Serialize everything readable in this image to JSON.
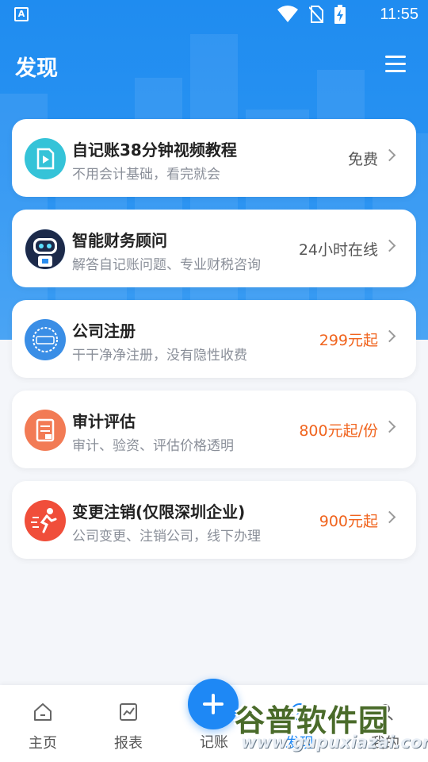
{
  "status_bar": {
    "time": "11:55",
    "app_badge": "A"
  },
  "header": {
    "title": "发现"
  },
  "cards": [
    {
      "title": "自记账38分钟视频教程",
      "subtitle": "不用会计基础，看完就会",
      "right": "免费",
      "right_color": "#555555",
      "icon": "video-tutorial-icon",
      "icon_color": "#35c3d8"
    },
    {
      "title": "智能财务顾问",
      "subtitle": "解答自记账问题、专业财税咨询",
      "right": "24小时在线",
      "right_color": "#555555",
      "icon": "robot-advisor-icon",
      "icon_color": "#1c2a4a"
    },
    {
      "title": "公司注册",
      "subtitle": "干干净净注册，没有隐性收费",
      "right": "299元起",
      "right_color": "#f0641e",
      "icon": "register-seal-icon",
      "icon_color": "#3a8ee6"
    },
    {
      "title": "审计评估",
      "subtitle": "审计、验资、评估价格透明",
      "right": "800元起/份",
      "right_color": "#f0641e",
      "icon": "audit-document-icon",
      "icon_color": "#f27b55"
    },
    {
      "title": "变更注销(仅限深圳企业)",
      "subtitle": "公司变更、注销公司，线下办理",
      "right": "900元起",
      "right_color": "#f0641e",
      "icon": "running-person-icon",
      "icon_color": "#f04e3a"
    }
  ],
  "tabbar": {
    "home": "主页",
    "reports": "报表",
    "bookkeeping": "记账",
    "discover": "发现",
    "mine": "我的"
  },
  "watermark": {
    "cn": "谷普软件园",
    "en": "www.gupuxiazai.com"
  },
  "colors": {
    "brand_blue": "#1e88f5",
    "price_orange": "#f0641e"
  }
}
